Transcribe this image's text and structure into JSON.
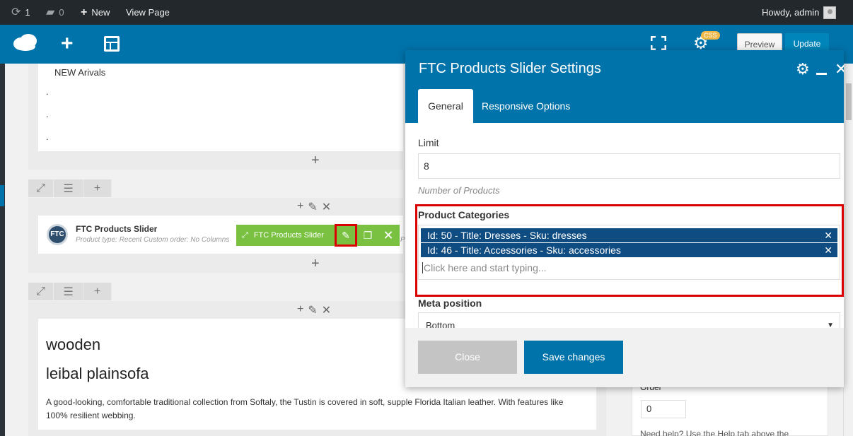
{
  "adminbar": {
    "updates_count": "1",
    "comments_count": "0",
    "new_label": "New",
    "view_page_label": "View Page",
    "howdy": "Howdy, admin"
  },
  "vc_toolbar": {
    "css_badge": "CSS",
    "preview_label": "Preview",
    "update_label": "Update"
  },
  "content": {
    "new_arivals": "NEW Arivals",
    "dots": [
      ".",
      ".",
      "."
    ],
    "ftc_element": {
      "logo": "FTC",
      "title": "FTC Products Slider",
      "meta": "Product type: Recent  Custom order: No  Columns",
      "meta_cut": "P"
    },
    "green_controls": {
      "label": "FTC Products Slider"
    },
    "text_block": {
      "heading1": "wooden",
      "heading2": "leibal plainsofa",
      "paragraph": "A good-looking, comfortable traditional collection from Softaly, the Tustin is covered in soft, supple Florida Italian leather. With features like 100% resilient webbing."
    }
  },
  "sidebar_box": {
    "order_label": "Order",
    "order_value": "0",
    "help_text": "Need help? Use the Help tab above the"
  },
  "modal": {
    "title": "FTC Products Slider Settings",
    "tabs": [
      {
        "label": "General",
        "active": true
      },
      {
        "label": "Responsive Options",
        "active": false
      }
    ],
    "limit": {
      "label": "Limit",
      "value": "8",
      "help": "Number of Products"
    },
    "product_categories": {
      "label": "Product Categories",
      "selected": [
        "Id: 50 - Title: Dresses - Sku: dresses",
        "Id: 46 - Title: Accessories - Sku: accessories"
      ],
      "placeholder": "Click here and start typing..."
    },
    "meta_position": {
      "label": "Meta position",
      "value": "Bottom"
    },
    "buttons": {
      "close": "Close",
      "save": "Save changes"
    }
  },
  "colors": {
    "wp_admin_bar": "#23282d",
    "vc_blue": "#0073aa",
    "element_green": "#7ac142",
    "chip_blue": "#0f4c81",
    "highlight_red": "#dd0000"
  }
}
